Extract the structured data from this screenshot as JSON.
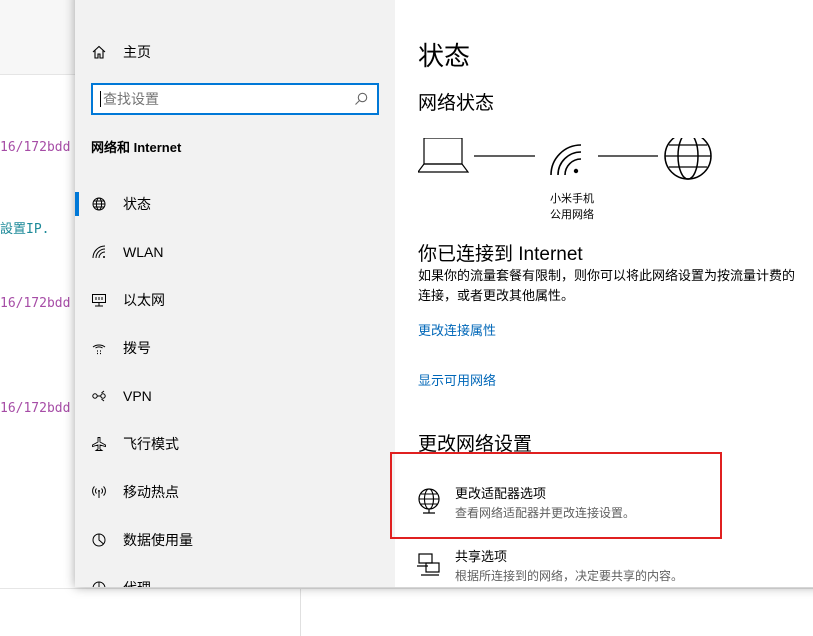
{
  "background": {
    "code_lines": [
      {
        "text": "16/172bdd",
        "color": "purple"
      },
      {
        "text": "設置IP.",
        "color": "teal"
      },
      {
        "text": "16/172bdd",
        "color": "purple"
      },
      {
        "text": "16/172bdd",
        "color": "purple"
      }
    ]
  },
  "nav": {
    "home_label": "主页",
    "search_placeholder": "查找设置",
    "section_title": "网络和 Internet",
    "items": [
      {
        "label": "状态",
        "icon": "globe-icon",
        "active": true
      },
      {
        "label": "WLAN",
        "icon": "wifi-icon"
      },
      {
        "label": "以太网",
        "icon": "ethernet-icon"
      },
      {
        "label": "拨号",
        "icon": "dialup-icon"
      },
      {
        "label": "VPN",
        "icon": "vpn-icon"
      },
      {
        "label": "飞行模式",
        "icon": "airplane-icon"
      },
      {
        "label": "移动热点",
        "icon": "hotspot-icon"
      },
      {
        "label": "数据使用量",
        "icon": "data-usage-icon"
      },
      {
        "label": "代理",
        "icon": "proxy-icon"
      }
    ]
  },
  "main": {
    "title": "状态",
    "network_status_heading": "网络状态",
    "phone_label_line1": "小米手机",
    "phone_label_line2": "公用网络",
    "connected_heading": "你已连接到 Internet",
    "connected_desc_line1": "如果你的流量套餐有限制，则你可以将此网络设置为按流量计费的",
    "connected_desc_line2": "连接，或者更改其他属性。",
    "link_change_properties": "更改连接属性",
    "link_show_networks": "显示可用网络",
    "change_settings_heading": "更改网络设置",
    "options": [
      {
        "title": "更改适配器选项",
        "desc": "查看网络适配器并更改连接设置。",
        "icon": "adapter-globe-icon"
      },
      {
        "title": "共享选项",
        "desc": "根据所连接到的网络，决定要共享的内容。",
        "icon": "sharing-icon"
      }
    ]
  },
  "colors": {
    "accent": "#0078d7",
    "link": "#0067b8",
    "highlight_border": "#e02020"
  }
}
